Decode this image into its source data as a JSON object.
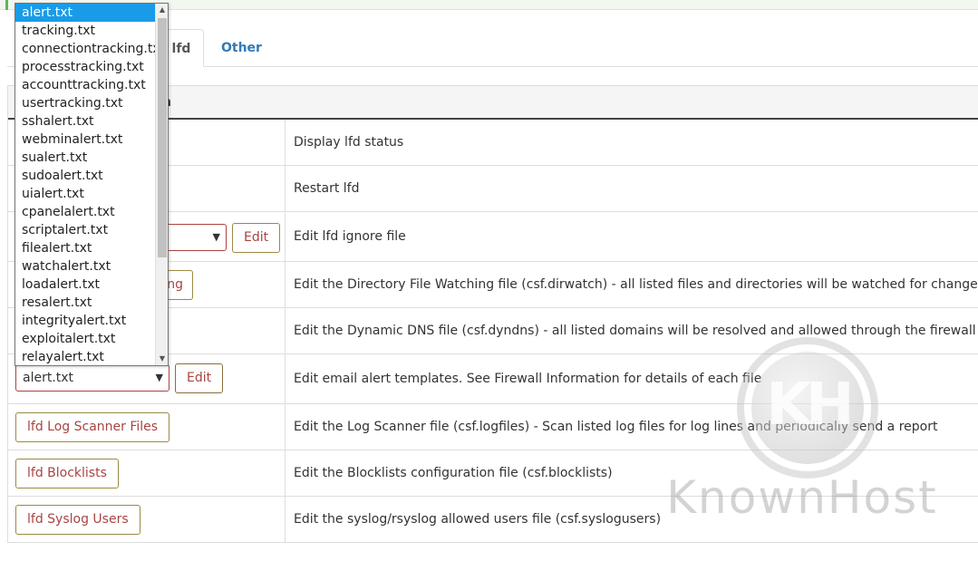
{
  "tabs": [
    {
      "label": "lfd",
      "active": true
    },
    {
      "label": "Other",
      "active": false
    }
  ],
  "table": {
    "header": "n",
    "rows": [
      {
        "description": "Display lfd status"
      },
      {
        "description": "Restart lfd"
      },
      {
        "control": "Edit",
        "description": "Edit lfd ignore file"
      },
      {
        "control": "ng",
        "description": "Edit the Directory File Watching file (csf.dirwatch) - all listed files and directories will be watched for changes by lfd"
      },
      {
        "description": "Edit the Dynamic DNS file (csf.dyndns) - all listed domains will be resolved and allowed through the firewall"
      },
      {
        "select_value": "alert.txt",
        "control": "Edit",
        "description": "Edit email alert templates. See Firewall Information for details of each file"
      },
      {
        "control": "lfd Log Scanner Files",
        "description": "Edit the Log Scanner file (csf.logfiles) - Scan listed log files for log lines and periodically send a report"
      },
      {
        "control": "lfd Blocklists",
        "description": "Edit the Blocklists configuration file (csf.blocklists)"
      },
      {
        "control": "lfd Syslog Users",
        "description": "Edit the syslog/rsyslog allowed users file (csf.syslogusers)"
      }
    ]
  },
  "dropdown": {
    "options": [
      "alert.txt",
      "tracking.txt",
      "connectiontracking.txt",
      "processtracking.txt",
      "accounttracking.txt",
      "usertracking.txt",
      "sshalert.txt",
      "webminalert.txt",
      "sualert.txt",
      "sudoalert.txt",
      "uialert.txt",
      "cpanelalert.txt",
      "scriptalert.txt",
      "filealert.txt",
      "watchalert.txt",
      "loadalert.txt",
      "resalert.txt",
      "integrityalert.txt",
      "exploitalert.txt",
      "relayalert.txt"
    ],
    "selected": "alert.txt"
  },
  "watermark": {
    "text": "KnownHost",
    "monogram": "KH"
  },
  "colors": {
    "link": "#337ab7",
    "button_text": "#a94442",
    "selected_option": "#1a9be8"
  }
}
